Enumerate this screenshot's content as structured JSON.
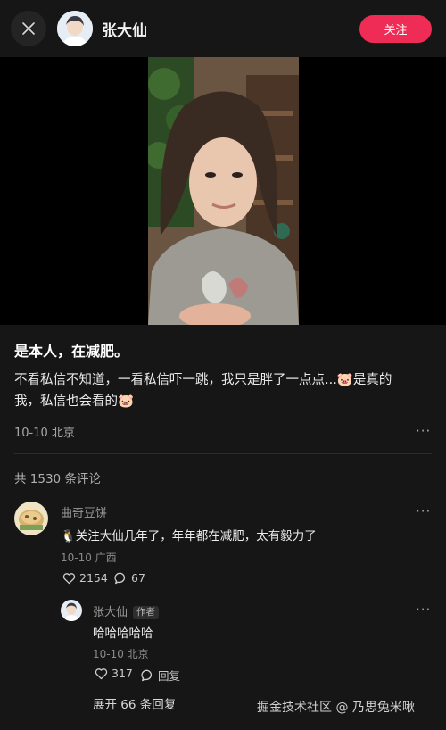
{
  "header": {
    "username": "张大仙",
    "follow_label": "关注"
  },
  "post": {
    "title": "是本人，在减肥。",
    "body_line1": "不看私信不知道，一看私信吓一跳，我只是胖了一点点...🐷是真的",
    "body_line2": "我，私信也会看的🐷",
    "meta": "10-10 北京"
  },
  "comments": {
    "count_label": "共 1530 条评论",
    "items": [
      {
        "name": "曲奇豆饼",
        "text": "🐧关注大仙几年了，年年都在减肥，太有毅力了",
        "meta": "10-10 广西",
        "likes": "2154",
        "replies": "67"
      }
    ],
    "reply": {
      "name": "张大仙",
      "author_tag": "作者",
      "text": "哈哈哈哈哈",
      "meta": "10-10 北京",
      "likes": "317",
      "reply_label": "回复"
    },
    "expand_label": "展开 66 条回复"
  },
  "watermark": "掘金技术社区 @ 乃思兔米啾",
  "icons": [
    "close-icon",
    "heart-icon",
    "comment-icon",
    "more-icon"
  ]
}
